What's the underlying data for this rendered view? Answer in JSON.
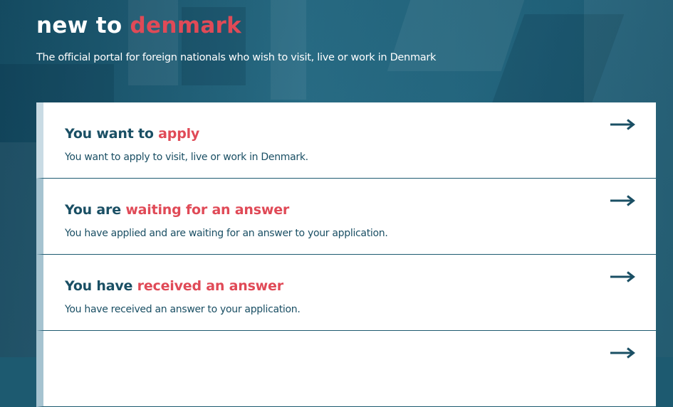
{
  "header": {
    "logo_part1": "new to",
    "logo_part2": "denmark",
    "tagline": "The official portal for foreign nationals who wish to visit, live or work in Denmark"
  },
  "cards": [
    {
      "title_prefix": "You want to",
      "title_highlight": "apply",
      "description": "You want to apply to visit, live or work in Denmark.",
      "icon": "arrow-right-icon"
    },
    {
      "title_prefix": "You are",
      "title_highlight": "waiting for an answer",
      "description": "You have applied and are waiting for an answer to your application.",
      "icon": "arrow-right-icon"
    },
    {
      "title_prefix": "You have",
      "title_highlight": "received an answer",
      "description": "You have received an answer to your application.",
      "icon": "arrow-right-icon"
    },
    {
      "title_prefix": "",
      "title_highlight": "",
      "description": "",
      "icon": "arrow-right-icon"
    }
  ],
  "colors": {
    "brand_blue": "#1a4f64",
    "brand_red": "#e04a57",
    "background": "#1d5a70"
  }
}
